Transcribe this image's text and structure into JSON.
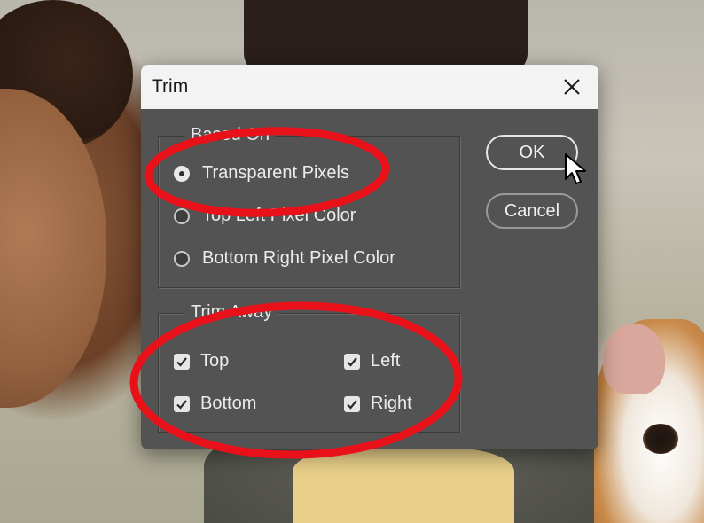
{
  "dialog": {
    "title": "Trim",
    "close_icon": "close-icon"
  },
  "based_on": {
    "legend": "Based On",
    "options": [
      {
        "label": "Transparent Pixels",
        "checked": true
      },
      {
        "label": "Top Left Pixel Color",
        "checked": false
      },
      {
        "label": "Bottom Right Pixel Color",
        "checked": false
      }
    ]
  },
  "trim_away": {
    "legend": "Trim Away",
    "options": [
      {
        "label": "Top",
        "checked": true
      },
      {
        "label": "Left",
        "checked": true
      },
      {
        "label": "Bottom",
        "checked": true
      },
      {
        "label": "Right",
        "checked": true
      }
    ]
  },
  "buttons": {
    "ok": "OK",
    "cancel": "Cancel"
  },
  "colors": {
    "dialog_bg": "#535353",
    "titlebar_bg": "#f3f3f3",
    "annotation": "#e8111a"
  },
  "icons": {
    "cursor": "arrow-cursor-icon",
    "checkmark": "checkmark-icon"
  }
}
